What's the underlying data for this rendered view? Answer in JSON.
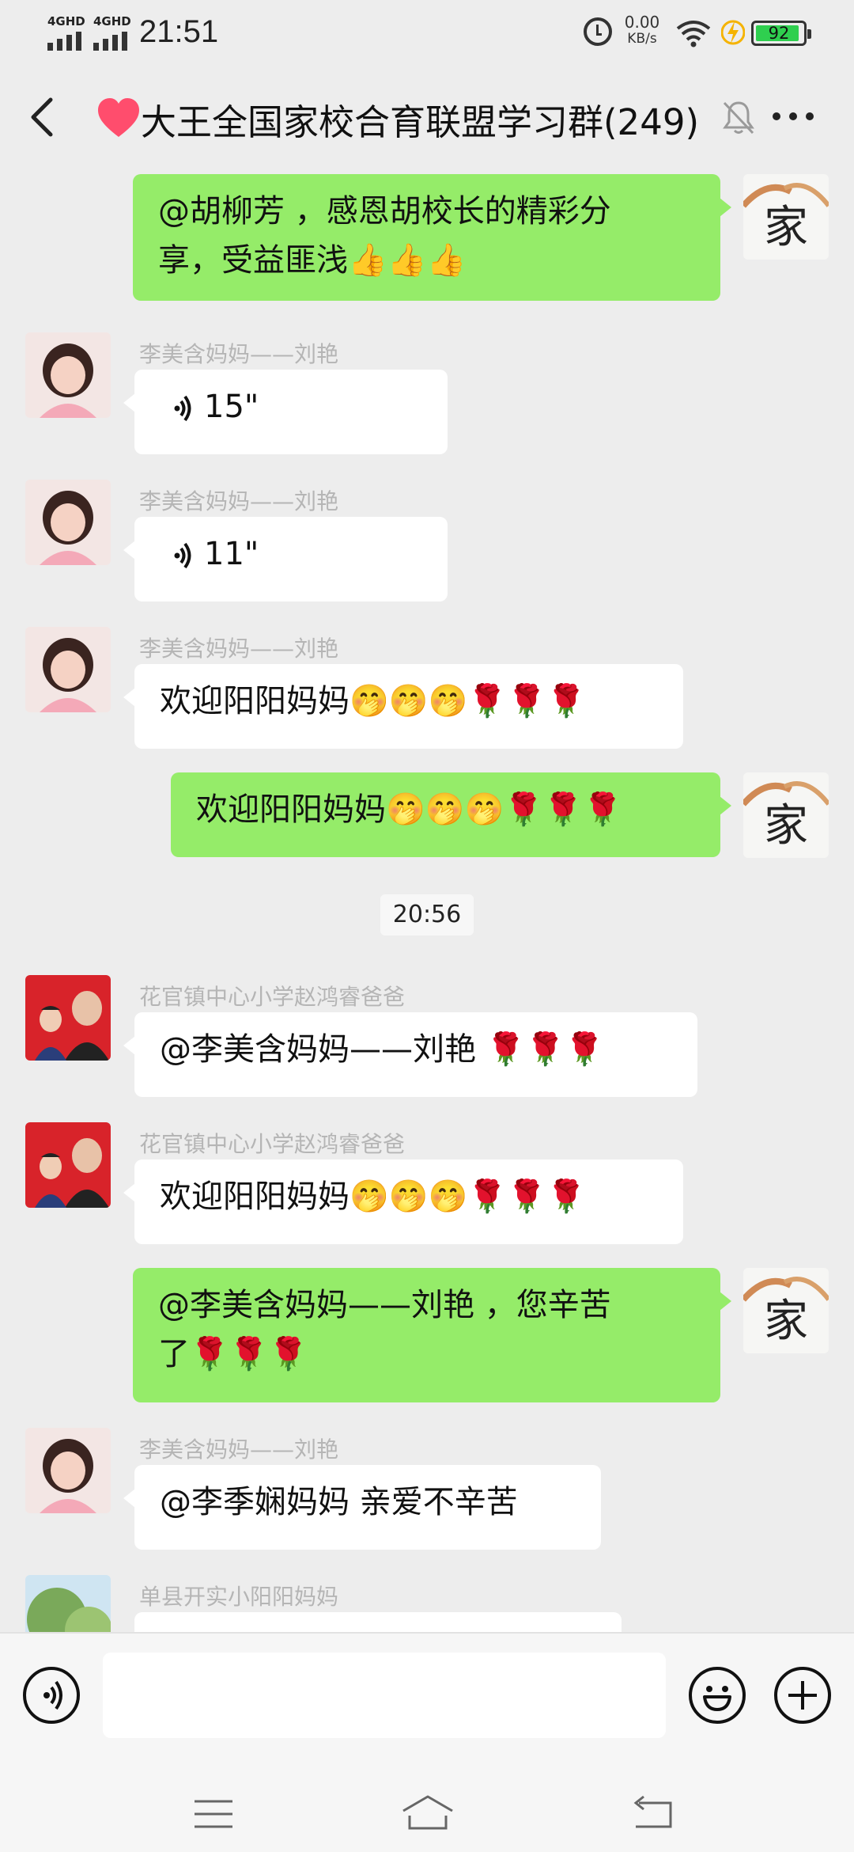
{
  "status_bar": {
    "network_1": "4GHD",
    "network_2": "4GHD",
    "time": "21:51",
    "speed_value": "0.00",
    "speed_unit": "KB/s",
    "battery": "92"
  },
  "header": {
    "title": "大王全国家校合育联盟学习群(249)",
    "icons": [
      "back-icon",
      "heart-icon",
      "mute-icon",
      "more-icon"
    ]
  },
  "chat": {
    "messages": [
      {
        "side": "right",
        "text_line1": "@胡柳芳 ，感恩胡校长的精彩分",
        "text_line2": "享，受益匪浅👍👍👍"
      },
      {
        "side": "left",
        "sender": "李美含妈妈——刘艳",
        "voice_duration": "15\""
      },
      {
        "side": "left",
        "sender": "李美含妈妈——刘艳",
        "voice_duration": "11\""
      },
      {
        "side": "left",
        "sender": "李美含妈妈——刘艳",
        "text": "欢迎阳阳妈妈🤭🤭🤭🌹🌹🌹"
      },
      {
        "side": "right",
        "text": "欢迎阳阳妈妈🤭🤭🤭🌹🌹🌹"
      },
      {
        "side": "left",
        "sender": "花官镇中心小学赵鸿睿爸爸",
        "text": "@李美含妈妈——刘艳 🌹🌹🌹"
      },
      {
        "side": "left",
        "sender": "花官镇中心小学赵鸿睿爸爸",
        "text": "欢迎阳阳妈妈🤭🤭🤭🌹🌹🌹"
      },
      {
        "side": "right",
        "text_line1": "@李美含妈妈——刘艳 ，您辛苦",
        "text_line2": "了🌹🌹🌹"
      },
      {
        "side": "left",
        "sender": "李美含妈妈——刘艳",
        "text": "@李季娴妈妈  亲爱不辛苦"
      },
      {
        "side": "left",
        "sender": "单县开实小阳阳妈妈",
        "text": ""
      }
    ],
    "timestamp": "20:56",
    "avatar_self_char": "家"
  },
  "input_bar": {
    "value": "",
    "icons": [
      "voice-icon",
      "emoji-icon",
      "plus-icon"
    ]
  },
  "system_nav": {
    "icons": [
      "menu-icon",
      "home-icon",
      "back-icon"
    ]
  },
  "colors": {
    "accent_bubble": "#95ec69",
    "background": "#ededed",
    "battery": "#2fcf4f",
    "heart": "#ff4d6d"
  }
}
